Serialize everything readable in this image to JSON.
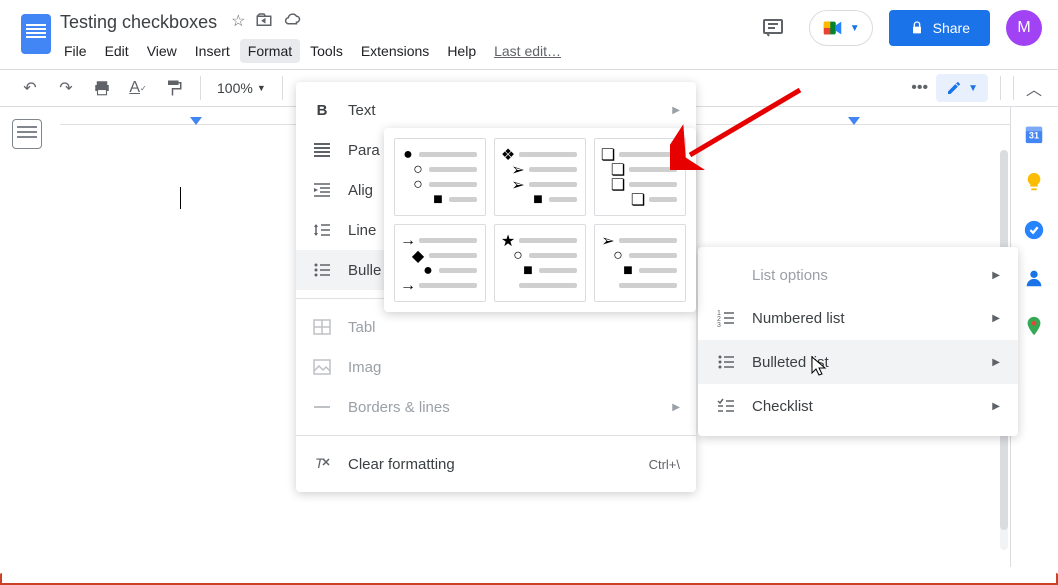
{
  "doc": {
    "title": "Testing checkboxes"
  },
  "menubar": {
    "items": [
      {
        "label": "File"
      },
      {
        "label": "Edit"
      },
      {
        "label": "View"
      },
      {
        "label": "Insert"
      },
      {
        "label": "Format"
      },
      {
        "label": "Tools"
      },
      {
        "label": "Extensions"
      },
      {
        "label": "Help"
      }
    ],
    "last_edit": "Last edit…"
  },
  "toolbar": {
    "zoom": "100%",
    "more": "•••"
  },
  "header": {
    "share_label": "Share",
    "avatar_initial": "M"
  },
  "format_menu": {
    "items": [
      {
        "label": "Text",
        "icon": "B",
        "arrow": true
      },
      {
        "label": "Paragraph styles",
        "icon": "para",
        "arrow": true,
        "truncated": "Para"
      },
      {
        "label": "Align & indent",
        "icon": "align",
        "arrow": true,
        "truncated": "Alig"
      },
      {
        "label": "Line & paragraph spacing",
        "icon": "linespace",
        "arrow": true,
        "truncated": "Line"
      },
      {
        "label": "Bullets & numbering",
        "icon": "bullets",
        "arrow": true,
        "truncated": "Bulle",
        "hover": true
      }
    ],
    "group2": [
      {
        "label": "Table",
        "icon": "table",
        "truncated": "Tabl",
        "disabled": true
      },
      {
        "label": "Image",
        "icon": "image",
        "truncated": "Imag",
        "disabled": true
      },
      {
        "label": "Borders & lines",
        "icon": "border",
        "arrow": true,
        "disabled": true
      }
    ],
    "group3": [
      {
        "label": "Clear formatting",
        "icon": "clear",
        "shortcut": "Ctrl+\\"
      }
    ]
  },
  "submenu": {
    "items": [
      {
        "label": "List options",
        "arrow": true,
        "disabled": true
      },
      {
        "label": "Numbered list",
        "icon": "numbered",
        "arrow": true
      },
      {
        "label": "Bulleted list",
        "icon": "bulleted",
        "arrow": true,
        "hover": true
      },
      {
        "label": "Checklist",
        "icon": "checklist",
        "arrow": true
      }
    ]
  },
  "bullet_presets": [
    {
      "id": "disc-circle-circle-square",
      "symbols": [
        "●",
        "○",
        "○",
        "■"
      ]
    },
    {
      "id": "diamond-arrow-arrow-square",
      "symbols": [
        "◆",
        "➤",
        "➤",
        "■"
      ]
    },
    {
      "id": "checkbox-square",
      "symbols": [
        "❏",
        "❏",
        "❏",
        "❏"
      ]
    },
    {
      "id": "arrow-diamond-disc-arrow",
      "symbols": [
        "→",
        "◆",
        "●",
        "→"
      ]
    },
    {
      "id": "star-circle-square",
      "symbols": [
        "★",
        "○",
        "■",
        ""
      ]
    },
    {
      "id": "arrow-circle-square",
      "symbols": [
        "➤",
        "○",
        "■",
        ""
      ]
    }
  ],
  "side_panel": {
    "icons": [
      "calendar",
      "keep",
      "tasks",
      "contacts",
      "maps"
    ]
  }
}
